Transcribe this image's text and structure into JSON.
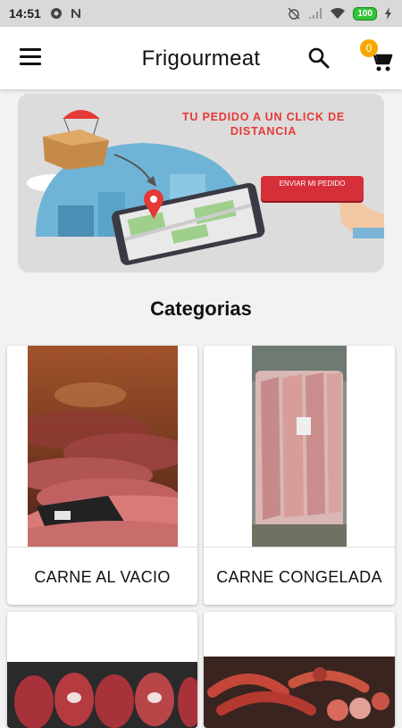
{
  "status_bar": {
    "time": "14:51",
    "battery": "100"
  },
  "app_bar": {
    "title": "Frigourmeat",
    "cart_count": "0"
  },
  "banner": {
    "headline": "TU PEDIDO A UN CLICK DE DISTANCIA",
    "cta": "ENVIAR MI PEDIDO"
  },
  "categories": {
    "title": "Categorias",
    "items": [
      {
        "label": "CARNE AL VACIO"
      },
      {
        "label": "CARNE CONGELADA"
      }
    ]
  },
  "colors": {
    "accent_badge": "#f5a800",
    "banner_red": "#e53935"
  }
}
